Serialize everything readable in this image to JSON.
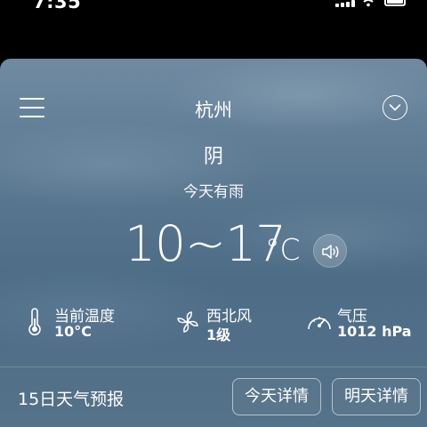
{
  "status_bar": {
    "time": "7:35"
  },
  "header": {
    "city": "杭州"
  },
  "weather": {
    "condition": "阴",
    "forecast_text": "今天有雨",
    "temp_range": "10~17",
    "temp_unit": "°C"
  },
  "metrics": [
    {
      "label": "当前温度",
      "value": "10°C",
      "icon": "thermometer-icon"
    },
    {
      "label": "西北风",
      "value": "1级",
      "icon": "wind-fan-icon"
    },
    {
      "label": "气压",
      "value": "1012 hPa",
      "icon": "gauge-icon"
    }
  ],
  "footer": {
    "title": "15日天气预报",
    "today_button": "今天详情",
    "tomorrow_button": "明天详情"
  }
}
